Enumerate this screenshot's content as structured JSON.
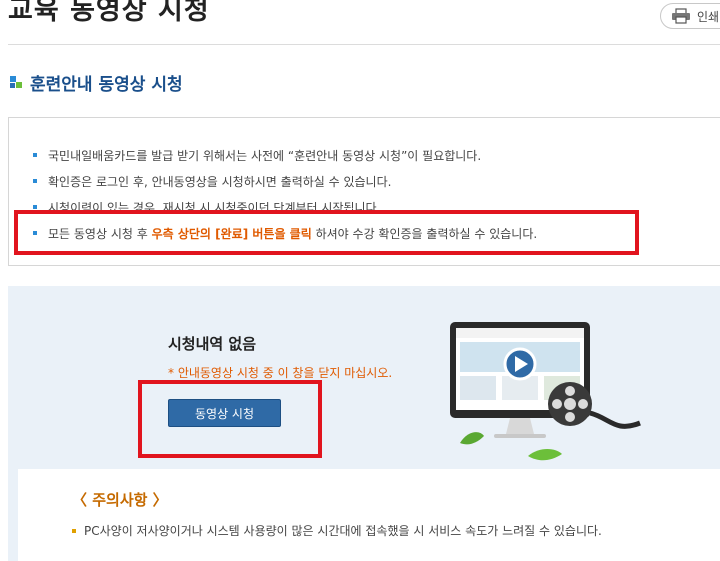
{
  "header": {
    "title": "교육 동영상 시청",
    "print_label": "인쇄"
  },
  "section": {
    "title": "훈련안내 동영상 시청"
  },
  "notices": [
    {
      "text": "국민내일배움카드를 발급 받기 위해서는 사전에 “훈련안내 동영상 시청”이 필요합니다."
    },
    {
      "text": "확인증은 로그인 후, 안내동영상을 시청하시면 출력하실 수 있습니다."
    },
    {
      "text": "시청이력이 있는 경우, 재시청 시 시청중이던 단계부터 시작됩니다."
    },
    {
      "pre": "모든 동영상 시청 후 ",
      "highlight": "우측 상단의 [완료] 버튼을 클릭",
      "post": " 하셔야 수강 확인증을 출력하실 수 있습니다."
    }
  ],
  "video": {
    "empty_title": "시청내역 없음",
    "warning": "* 안내동영상 시청 중 이 창을 닫지 마십시오.",
    "watch_button": "동영상 시청"
  },
  "caution": {
    "title": "〈 주의사항 〉",
    "items": [
      "PC사양이 저사양이거나 시스템 사용량이 많은 시간대에 접속했을 시 서비스 속도가 느려질 수 있습니다."
    ]
  },
  "icons": {
    "print": "printer-icon",
    "play": "play-icon",
    "film": "film-reel-icon"
  },
  "colors": {
    "title_blue": "#1a4f8b",
    "accent_orange": "#e05a00",
    "button_blue": "#2f6aa6",
    "annotation_red": "#e1141e",
    "video_bg": "#eaf1f8"
  }
}
